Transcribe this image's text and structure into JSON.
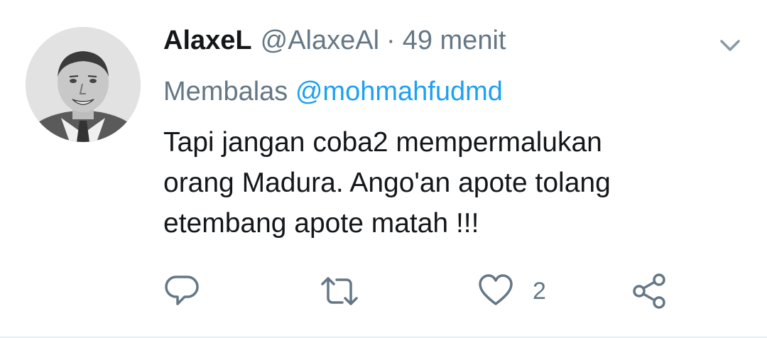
{
  "tweet": {
    "author_name": "AlaxeL",
    "author_handle": "@AlaxeAl",
    "separator": "·",
    "time": "49 menit",
    "reply_prefix": "Membalas",
    "reply_mention": "@mohmahfudmd",
    "text_lines": [
      "Tapi jangan coba2 mempermalukan",
      "orang Madura. Ango'an apote tolang",
      "etembang apote matah !!!"
    ]
  },
  "actions": {
    "reply_icon": "reply-icon",
    "retweet_icon": "retweet-icon",
    "like_icon": "heart-icon",
    "like_count": "2",
    "share_icon": "share-icon"
  },
  "colors": {
    "text": "#14171a",
    "secondary": "#657786",
    "link": "#1da1f2",
    "divider": "#e6ecf0"
  }
}
